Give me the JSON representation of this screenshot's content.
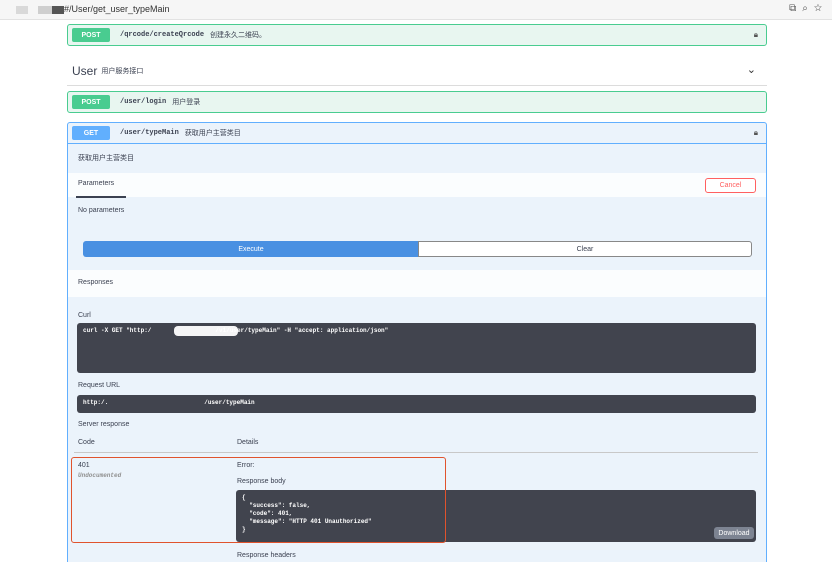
{
  "browser": {
    "url": "#/User/get_user_typeMain"
  },
  "endpoints": {
    "qrcode": {
      "method": "POST",
      "path": "/qrcode/createQrcode",
      "summary": "创建永久二维码。"
    },
    "login": {
      "method": "POST",
      "path": "/user/login",
      "summary": "用户登录"
    },
    "typeMain": {
      "method": "GET",
      "path": "/user/typeMain",
      "summary": "获取用户主营类目"
    }
  },
  "tag": {
    "name": "User",
    "description": "用户服务接口"
  },
  "operation": {
    "description": "获取用户主营类目",
    "parameters_tab": "Parameters",
    "cancel_label": "Cancel",
    "no_parameters": "No parameters",
    "execute_label": "Execute",
    "clear_label": "Clear",
    "responses_title": "Responses",
    "curl_label": "Curl",
    "curl_prefix": "curl -X GET \"http:/",
    "curl_suffix": "/v1/user/typeMain\" -H \"accept: application/json\"",
    "request_url_label": "Request URL",
    "request_url_prefix": "http:/.",
    "request_url_suffix": "/user/typeMain",
    "server_response_label": "Server response",
    "code_header": "Code",
    "details_header": "Details",
    "response_code": "401",
    "response_undocumented": "Undocumented",
    "error_label": "Error:",
    "response_body_label": "Response body",
    "response_body_lines": [
      "{",
      "  \"success\": false,",
      "  \"code\": 401,",
      "  \"message\": \"HTTP 401 Unauthorized\"",
      "}"
    ],
    "download_label": "Download",
    "response_headers_label": "Response headers"
  },
  "colors": {
    "post": "#49cc90",
    "get": "#61affe",
    "execute": "#4990e2",
    "highlight": "#e0532d"
  }
}
